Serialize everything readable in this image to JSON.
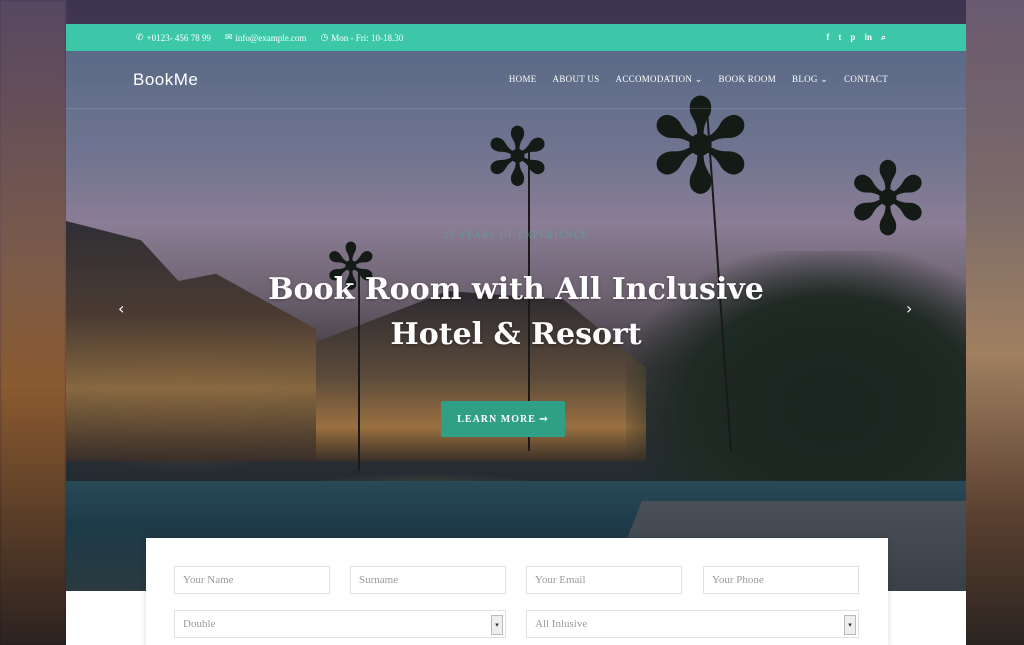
{
  "topbar": {
    "phone": "+0123- 456 78 99",
    "email": "info@example.com",
    "hours": "Mon - Fri: 10-18.30",
    "social_icons": [
      "facebook-icon",
      "twitter-icon",
      "pinterest-icon",
      "linkedin-icon",
      "search-icon"
    ],
    "social_glyphs": [
      "f",
      "t",
      "p",
      "in",
      "⌕"
    ]
  },
  "brand": {
    "logo": "BookMe",
    "accent": "#3cc8a8",
    "button": "#2f9f86"
  },
  "nav": {
    "items": [
      {
        "label": "HOME"
      },
      {
        "label": "ABOUT US"
      },
      {
        "label": "ACCOMODATION ⌄"
      },
      {
        "label": "BOOK ROOM"
      },
      {
        "label": "BLOG ⌄"
      },
      {
        "label": "CONTACT"
      }
    ]
  },
  "hero": {
    "eyebrow": "25 YEARS OF EXPERIENCE",
    "headline_line1": "Book Room with All Inclusive",
    "headline_line2": "Hotel & Resort",
    "cta": "LEARN MORE ➞",
    "prev": "‹",
    "next": "›"
  },
  "booking": {
    "name_placeholder": "Your Name",
    "surname_placeholder": "Surname",
    "email_placeholder": "Your Email",
    "phone_placeholder": "Your Phone",
    "room_type": "Double",
    "package": "All Inlusive"
  }
}
